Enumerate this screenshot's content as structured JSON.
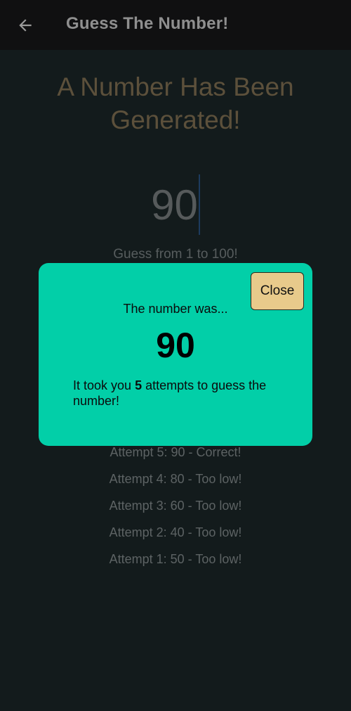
{
  "app_bar": {
    "back_icon": "arrow-left-icon",
    "title": "Guess The Number!"
  },
  "main": {
    "headline_line1": "A Number Has Been",
    "headline_line2": "Generated!",
    "guess_value": "90",
    "range_hint": "Guess from 1 to 100!",
    "attempts": [
      "Attempt 5: 90 - Correct!",
      "Attempt 4: 80 - Too low!",
      "Attempt 3: 60 - Too low!",
      "Attempt 2: 40 - Too low!",
      "Attempt 1: 50 - Too low!"
    ]
  },
  "dialog": {
    "close_label": "Close",
    "reveal_label": "The number was...",
    "reveal_number": "90",
    "summary_prefix": "It took you ",
    "attempt_count": "5",
    "summary_suffix": " attempts to guess the number!"
  },
  "colors": {
    "dialog_bg": "#02cfa8",
    "close_button_bg": "#e8ca8b",
    "app_bar_bg": "#101011",
    "screen_bg": "#131b1c"
  }
}
